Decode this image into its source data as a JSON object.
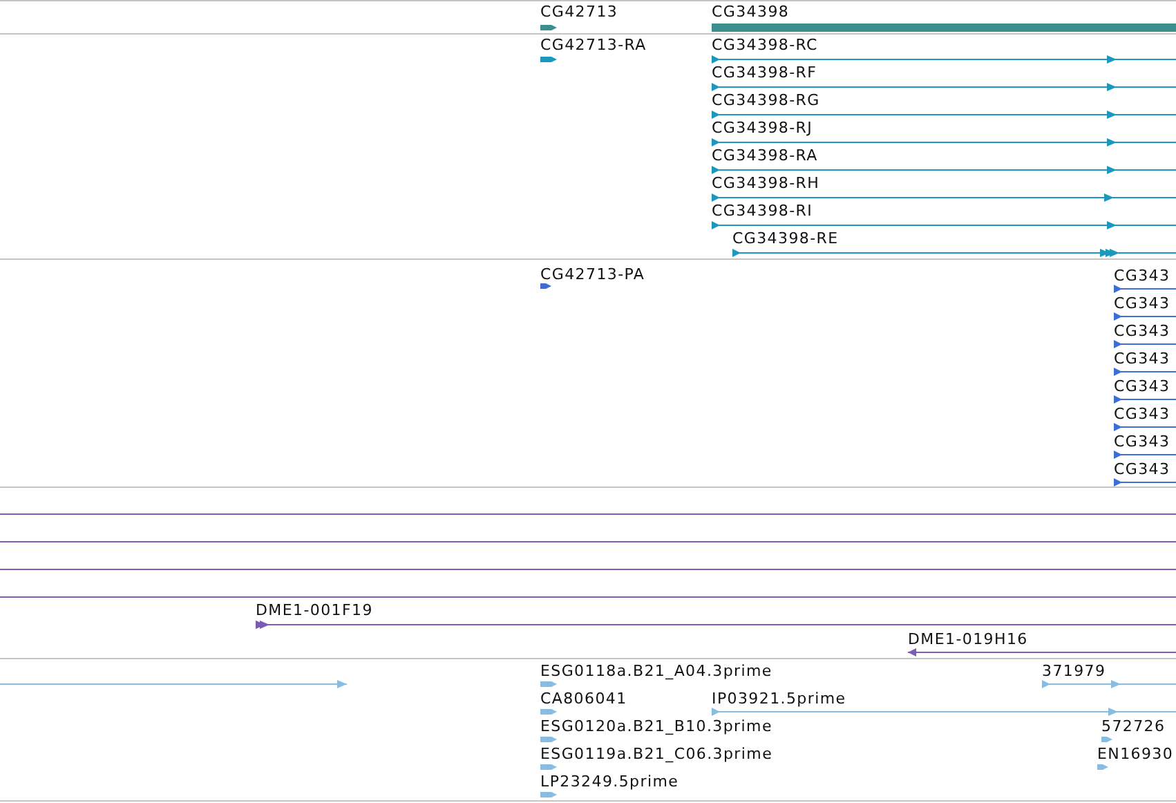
{
  "tracks": [
    {
      "kind": "gene",
      "features": [
        {
          "kind": "chevron",
          "label": "CG42713",
          "reverse": false
        },
        {
          "kind": "bar",
          "label": "CG34398"
        }
      ]
    },
    {
      "kind": "transcript",
      "features": [
        {
          "kind": "chevron",
          "label": "CG42713-RA",
          "reverse": false
        },
        {
          "kind": "line",
          "label": "CG34398-RC",
          "reverse": false
        },
        {
          "kind": "line",
          "label": "CG34398-RF",
          "reverse": false
        },
        {
          "kind": "line",
          "label": "CG34398-RG",
          "reverse": false
        },
        {
          "kind": "line",
          "label": "CG34398-RJ",
          "reverse": false
        },
        {
          "kind": "line",
          "label": "CG34398-RA",
          "reverse": false
        },
        {
          "kind": "line",
          "label": "CG34398-RH",
          "reverse": false
        },
        {
          "kind": "line",
          "label": "CG34398-RI",
          "reverse": false
        },
        {
          "kind": "line",
          "label": "CG34398-RE",
          "reverse": false
        }
      ]
    },
    {
      "kind": "protein",
      "features": [
        {
          "kind": "chevron",
          "label": "CG42713-PA",
          "reverse": false
        },
        {
          "kind": "line",
          "label": "CG343",
          "reverse": false
        },
        {
          "kind": "line",
          "label": "CG343",
          "reverse": false
        },
        {
          "kind": "line",
          "label": "CG343",
          "reverse": false
        },
        {
          "kind": "line",
          "label": "CG343",
          "reverse": false
        },
        {
          "kind": "line",
          "label": "CG343",
          "reverse": false
        },
        {
          "kind": "line",
          "label": "CG343",
          "reverse": false
        },
        {
          "kind": "line",
          "label": "CG343",
          "reverse": false
        },
        {
          "kind": "line",
          "label": "CG343",
          "reverse": false
        }
      ]
    },
    {
      "kind": "clone",
      "features": [
        {
          "kind": "line"
        },
        {
          "kind": "line"
        },
        {
          "kind": "line"
        },
        {
          "kind": "line"
        },
        {
          "kind": "line",
          "label": "DME1-001F19",
          "reverse": false
        },
        {
          "kind": "line",
          "label": "DME1-019H16",
          "reverse": true
        }
      ]
    },
    {
      "kind": "est",
      "features": [
        {
          "kind": "line",
          "reverse": false
        },
        {
          "kind": "chevron",
          "label": "ESG0118a.B21_A04.3prime",
          "reverse": false
        },
        {
          "kind": "line",
          "label": "371979",
          "reverse": false
        },
        {
          "kind": "chevron",
          "label": "CA806041",
          "reverse": false
        },
        {
          "kind": "line",
          "label": "IP03921.5prime",
          "reverse": false
        },
        {
          "kind": "chevron",
          "label": "ESG0120a.B21_B10.3prime",
          "reverse": false
        },
        {
          "kind": "chevron",
          "label": "572726",
          "reverse": false
        },
        {
          "kind": "chevron",
          "label": "ESG0119a.B21_C06.3prime",
          "reverse": false
        },
        {
          "kind": "chevron",
          "label": "EN16930",
          "reverse": false
        },
        {
          "kind": "chevron",
          "label": "LP23249.5prime",
          "reverse": false
        }
      ]
    }
  ]
}
